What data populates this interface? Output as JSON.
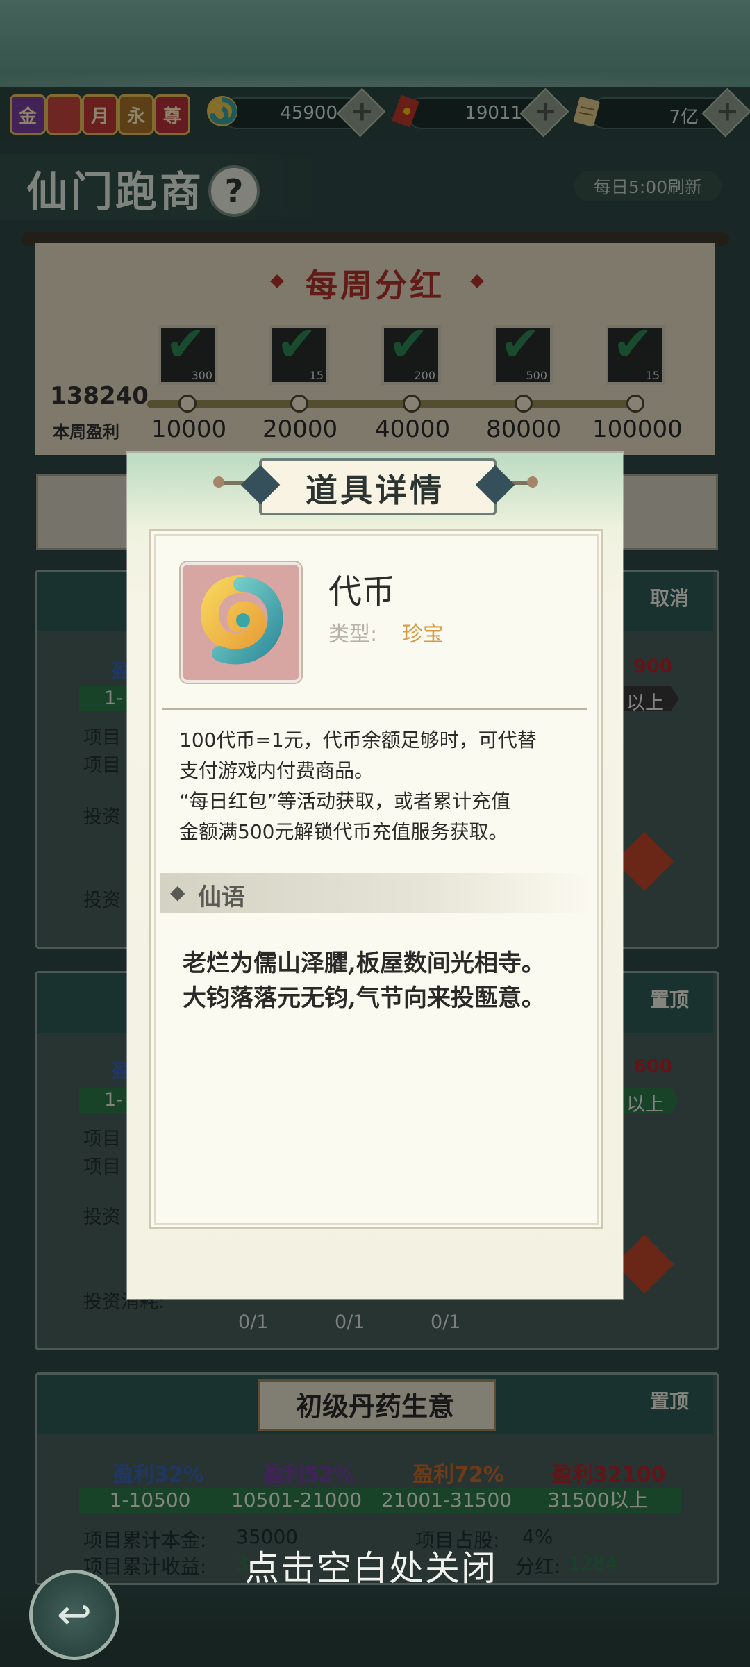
{
  "header": {
    "vip_badges": [
      "金",
      "",
      "月",
      "永",
      "尊"
    ],
    "resources": [
      {
        "icon": "token-coin-icon",
        "value": "45900"
      },
      {
        "icon": "red-envelope-icon",
        "value": "19011"
      },
      {
        "icon": "scroll-ticket-icon",
        "value": "7亿"
      }
    ],
    "plus_glyph": "+"
  },
  "page": {
    "title": "仙门跑商",
    "help_glyph": "?",
    "refresh_text": "每日5:00刷新"
  },
  "weekly": {
    "title": "每周分红",
    "current_profit": "138240",
    "current_label": "本周盈利",
    "milestones": [
      "10000",
      "20000",
      "40000",
      "80000",
      "100000"
    ],
    "reward_counts": [
      "300",
      "15",
      "200",
      "500",
      "15"
    ]
  },
  "background_cards": {
    "cancel_label": "取消",
    "pin_label": "置顶",
    "partial_labels": [
      "盈",
      "1-",
      "项目",
      "项目",
      "投资",
      "投资"
    ],
    "partial_right_values": [
      "900",
      "以上",
      "600",
      "以上"
    ],
    "invest_label": "投资消耗:",
    "counters": [
      "0/1",
      "0/1",
      "0/1"
    ],
    "bottom_card": {
      "title": "初级丹药生意",
      "tiers": [
        {
          "label": "盈利32%",
          "color": "#3b64b4"
        },
        {
          "label": "盈利52%",
          "color": "#7b3da8"
        },
        {
          "label": "盈利72%",
          "color": "#c86a2a"
        },
        {
          "label": "盈利32100",
          "color": "#b3262a"
        }
      ],
      "ranges": [
        "1-10500",
        "10501-21000",
        "21001-31500",
        "31500以上"
      ],
      "stat_principal_label": "项目累计本金:",
      "stat_principal_value": "35000",
      "stat_income_label": "项目累计收益:",
      "stat_income_value": "3",
      "stat_share_label": "项目占股:",
      "stat_share_value": "4%",
      "stat_dividend_label": "分红:",
      "stat_dividend_value": "1284"
    }
  },
  "modal": {
    "title": "道具详情",
    "item_name": "代币",
    "type_label": "类型:",
    "type_value": "珍宝",
    "description_lines": [
      "100代币=1元，代币余额足够时，可代替",
      "支付游戏内付费商品。",
      "“每日红包”等活动获取，或者累计充值",
      "金额满500元解锁代币充值服务获取。"
    ],
    "section_title": "仙语",
    "poem_lines": [
      "老烂为儒山泽臞,板屋数间光相寺。",
      "大钧落落元无钧,气节向来投匦意。"
    ]
  },
  "close_hint": "点击空白处关闭",
  "back_glyph": "↩"
}
